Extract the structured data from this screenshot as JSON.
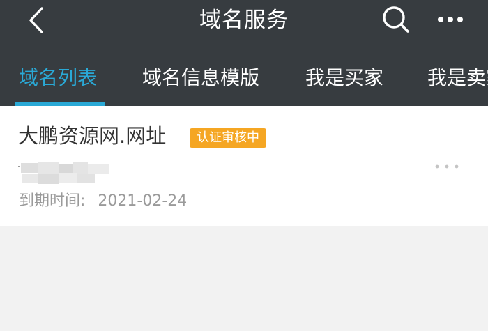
{
  "header": {
    "title": "域名服务",
    "back_icon": "chevron-left-icon",
    "search_icon": "search-icon",
    "more_icon": "more-horizontal-icon"
  },
  "tabs": [
    {
      "label": "域名列表",
      "active": true
    },
    {
      "label": "域名信息模版",
      "active": false
    },
    {
      "label": "我是买家",
      "active": false
    },
    {
      "label": "我是卖家",
      "active": false
    }
  ],
  "domain_card": {
    "name": "大鹏资源网.网址",
    "status": "认证审核中",
    "expiry_label": "到期时间:",
    "expiry_date": "2021-02-24",
    "more_icon": "more-horizontal-icon"
  },
  "colors": {
    "bar_bg": "#373c40",
    "accent": "#2aa9d6",
    "badge": "#f5a623",
    "page_bg": "#f2f2f2"
  }
}
